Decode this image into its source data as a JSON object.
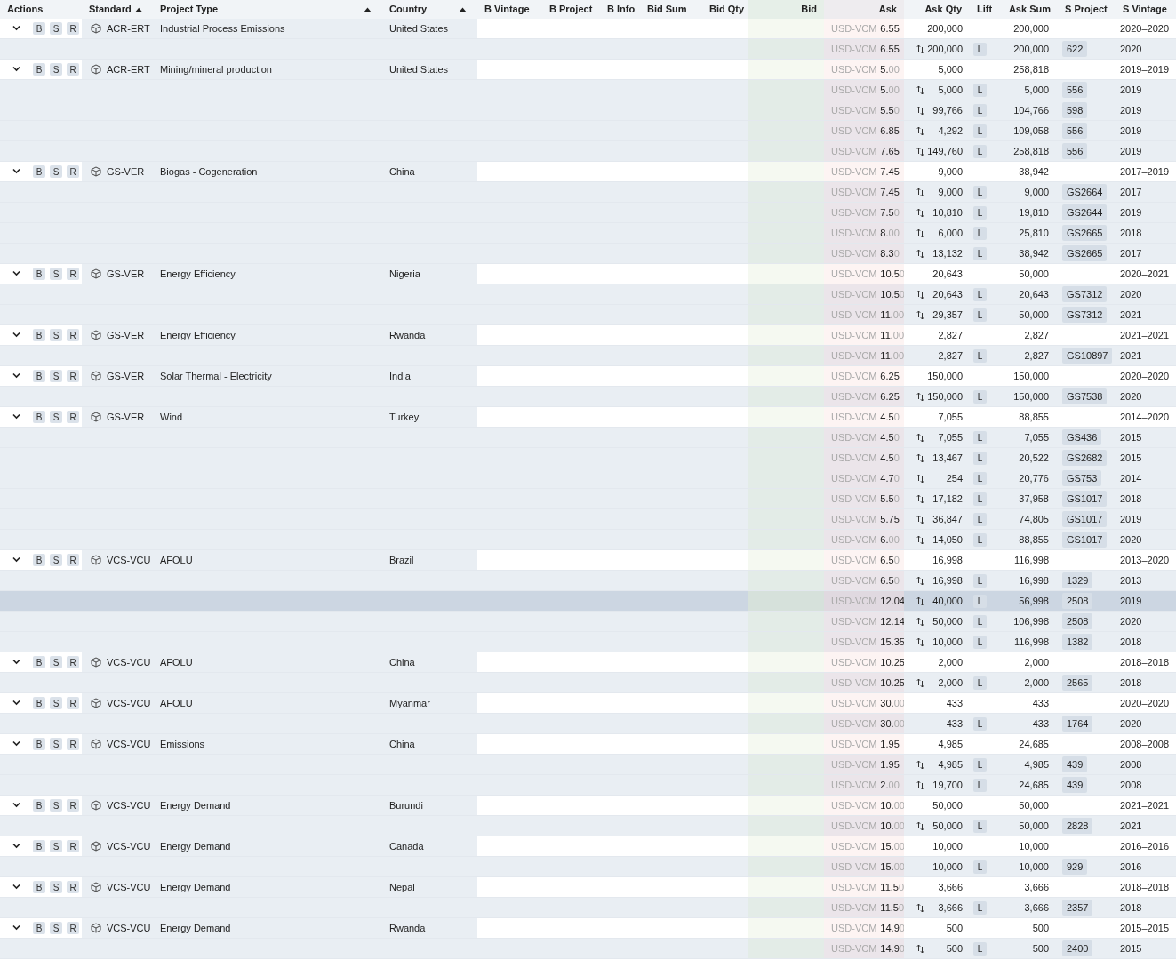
{
  "columns": [
    {
      "label": "Actions",
      "sorted": false
    },
    {
      "label": "Standard",
      "sorted": true
    },
    {
      "label": "Project Type",
      "sorted": true
    },
    {
      "label": "Country",
      "sorted": true
    },
    {
      "label": "B Vintage",
      "sorted": false
    },
    {
      "label": "B Project",
      "sorted": false
    },
    {
      "label": "B Info",
      "sorted": false
    },
    {
      "label": "Bid Sum",
      "sorted": false
    },
    {
      "label": "Bid Qty",
      "sorted": false
    },
    {
      "label": "Bid",
      "sorted": false
    },
    {
      "label": "Ask",
      "sorted": false
    },
    {
      "label": "Ask Qty",
      "sorted": false
    },
    {
      "label": "Lift",
      "sorted": false
    },
    {
      "label": "Ask Sum",
      "sorted": false
    },
    {
      "label": "S Project",
      "sorted": false
    },
    {
      "label": "S Vintage",
      "sorted": false
    }
  ],
  "groups": [
    {
      "expanded": true,
      "actions": [
        "B",
        "S",
        "R"
      ],
      "standard": "ACR-ERT",
      "project_type": "Industrial Process Emissions",
      "country": "United States",
      "summary": {
        "currency": "USD-VCM",
        "ask": "6.55",
        "ask_qty": "200,000",
        "ask_sum": "200,000",
        "s_vintage": "2020–2020"
      },
      "rows": [
        {
          "currency": "USD-VCM",
          "ask": "6.55",
          "swap": true,
          "ask_qty": "200,000",
          "lift": "L",
          "ask_sum": "200,000",
          "s_project": "622",
          "s_vintage": "2020",
          "highlighted": false
        }
      ]
    },
    {
      "expanded": true,
      "actions": [
        "B",
        "S",
        "R"
      ],
      "standard": "ACR-ERT",
      "project_type": "Mining/mineral production",
      "country": "United States",
      "summary": {
        "currency": "USD-VCM",
        "ask": "5.00",
        "ask_qty": "5,000",
        "ask_sum": "258,818",
        "s_vintage": "2019–2019"
      },
      "rows": [
        {
          "currency": "USD-VCM",
          "ask": "5.00",
          "swap": true,
          "ask_qty": "5,000",
          "lift": "L",
          "ask_sum": "5,000",
          "s_project": "556",
          "s_vintage": "2019",
          "highlighted": false
        },
        {
          "currency": "USD-VCM",
          "ask": "5.50",
          "swap": true,
          "ask_qty": "99,766",
          "lift": "L",
          "ask_sum": "104,766",
          "s_project": "598",
          "s_vintage": "2019",
          "highlighted": false
        },
        {
          "currency": "USD-VCM",
          "ask": "6.85",
          "swap": true,
          "ask_qty": "4,292",
          "lift": "L",
          "ask_sum": "109,058",
          "s_project": "556",
          "s_vintage": "2019",
          "highlighted": false
        },
        {
          "currency": "USD-VCM",
          "ask": "7.65",
          "swap": true,
          "ask_qty": "149,760",
          "lift": "L",
          "ask_sum": "258,818",
          "s_project": "556",
          "s_vintage": "2019",
          "highlighted": false
        }
      ]
    },
    {
      "expanded": true,
      "actions": [
        "B",
        "S",
        "R"
      ],
      "standard": "GS-VER",
      "project_type": "Biogas - Cogeneration",
      "country": "China",
      "summary": {
        "currency": "USD-VCM",
        "ask": "7.45",
        "ask_qty": "9,000",
        "ask_sum": "38,942",
        "s_vintage": "2017–2019"
      },
      "rows": [
        {
          "currency": "USD-VCM",
          "ask": "7.45",
          "swap": true,
          "ask_qty": "9,000",
          "lift": "L",
          "ask_sum": "9,000",
          "s_project": "GS2664",
          "s_vintage": "2017",
          "highlighted": false
        },
        {
          "currency": "USD-VCM",
          "ask": "7.50",
          "swap": true,
          "ask_qty": "10,810",
          "lift": "L",
          "ask_sum": "19,810",
          "s_project": "GS2644",
          "s_vintage": "2019",
          "highlighted": false
        },
        {
          "currency": "USD-VCM",
          "ask": "8.00",
          "swap": true,
          "ask_qty": "6,000",
          "lift": "L",
          "ask_sum": "25,810",
          "s_project": "GS2665",
          "s_vintage": "2018",
          "highlighted": false
        },
        {
          "currency": "USD-VCM",
          "ask": "8.30",
          "swap": true,
          "ask_qty": "13,132",
          "lift": "L",
          "ask_sum": "38,942",
          "s_project": "GS2665",
          "s_vintage": "2017",
          "highlighted": false
        }
      ]
    },
    {
      "expanded": true,
      "actions": [
        "B",
        "S",
        "R"
      ],
      "standard": "GS-VER",
      "project_type": "Energy Efficiency",
      "country": "Nigeria",
      "summary": {
        "currency": "USD-VCM",
        "ask": "10.50",
        "ask_qty": "20,643",
        "ask_sum": "50,000",
        "s_vintage": "2020–2021"
      },
      "rows": [
        {
          "currency": "USD-VCM",
          "ask": "10.50",
          "swap": true,
          "ask_qty": "20,643",
          "lift": "L",
          "ask_sum": "20,643",
          "s_project": "GS7312",
          "s_vintage": "2020",
          "highlighted": false
        },
        {
          "currency": "USD-VCM",
          "ask": "11.00",
          "swap": true,
          "ask_qty": "29,357",
          "lift": "L",
          "ask_sum": "50,000",
          "s_project": "GS7312",
          "s_vintage": "2021",
          "highlighted": false
        }
      ]
    },
    {
      "expanded": true,
      "actions": [
        "B",
        "S",
        "R"
      ],
      "standard": "GS-VER",
      "project_type": "Energy Efficiency",
      "country": "Rwanda",
      "summary": {
        "currency": "USD-VCM",
        "ask": "11.00",
        "ask_qty": "2,827",
        "ask_sum": "2,827",
        "s_vintage": "2021–2021"
      },
      "rows": [
        {
          "currency": "USD-VCM",
          "ask": "11.00",
          "swap": false,
          "ask_qty": "2,827",
          "lift": "L",
          "ask_sum": "2,827",
          "s_project": "GS10897",
          "s_vintage": "2021",
          "highlighted": false
        }
      ]
    },
    {
      "expanded": true,
      "actions": [
        "B",
        "S",
        "R"
      ],
      "standard": "GS-VER",
      "project_type": "Solar Thermal - Electricity",
      "country": "India",
      "summary": {
        "currency": "USD-VCM",
        "ask": "6.25",
        "ask_qty": "150,000",
        "ask_sum": "150,000",
        "s_vintage": "2020–2020"
      },
      "rows": [
        {
          "currency": "USD-VCM",
          "ask": "6.25",
          "swap": true,
          "ask_qty": "150,000",
          "lift": "L",
          "ask_sum": "150,000",
          "s_project": "GS7538",
          "s_vintage": "2020",
          "highlighted": false
        }
      ]
    },
    {
      "expanded": true,
      "actions": [
        "B",
        "S",
        "R"
      ],
      "standard": "GS-VER",
      "project_type": "Wind",
      "country": "Turkey",
      "summary": {
        "currency": "USD-VCM",
        "ask": "4.50",
        "ask_qty": "7,055",
        "ask_sum": "88,855",
        "s_vintage": "2014–2020"
      },
      "rows": [
        {
          "currency": "USD-VCM",
          "ask": "4.50",
          "swap": true,
          "ask_qty": "7,055",
          "lift": "L",
          "ask_sum": "7,055",
          "s_project": "GS436",
          "s_vintage": "2015",
          "highlighted": false
        },
        {
          "currency": "USD-VCM",
          "ask": "4.50",
          "swap": true,
          "ask_qty": "13,467",
          "lift": "L",
          "ask_sum": "20,522",
          "s_project": "GS2682",
          "s_vintage": "2015",
          "highlighted": false
        },
        {
          "currency": "USD-VCM",
          "ask": "4.70",
          "swap": true,
          "ask_qty": "254",
          "lift": "L",
          "ask_sum": "20,776",
          "s_project": "GS753",
          "s_vintage": "2014",
          "highlighted": false
        },
        {
          "currency": "USD-VCM",
          "ask": "5.50",
          "swap": true,
          "ask_qty": "17,182",
          "lift": "L",
          "ask_sum": "37,958",
          "s_project": "GS1017",
          "s_vintage": "2018",
          "highlighted": false
        },
        {
          "currency": "USD-VCM",
          "ask": "5.75",
          "swap": true,
          "ask_qty": "36,847",
          "lift": "L",
          "ask_sum": "74,805",
          "s_project": "GS1017",
          "s_vintage": "2019",
          "highlighted": false
        },
        {
          "currency": "USD-VCM",
          "ask": "6.00",
          "swap": true,
          "ask_qty": "14,050",
          "lift": "L",
          "ask_sum": "88,855",
          "s_project": "GS1017",
          "s_vintage": "2020",
          "highlighted": false
        }
      ]
    },
    {
      "expanded": true,
      "actions": [
        "B",
        "S",
        "R"
      ],
      "standard": "VCS-VCU",
      "project_type": "AFOLU",
      "country": "Brazil",
      "summary": {
        "currency": "USD-VCM",
        "ask": "6.50",
        "ask_qty": "16,998",
        "ask_sum": "116,998",
        "s_vintage": "2013–2020"
      },
      "rows": [
        {
          "currency": "USD-VCM",
          "ask": "6.50",
          "swap": true,
          "ask_qty": "16,998",
          "lift": "L",
          "ask_sum": "16,998",
          "s_project": "1329",
          "s_vintage": "2013",
          "highlighted": false
        },
        {
          "currency": "USD-VCM",
          "ask": "12.04",
          "swap": true,
          "ask_qty": "40,000",
          "lift": "L",
          "ask_sum": "56,998",
          "s_project": "2508",
          "s_vintage": "2019",
          "highlighted": true
        },
        {
          "currency": "USD-VCM",
          "ask": "12.14",
          "swap": true,
          "ask_qty": "50,000",
          "lift": "L",
          "ask_sum": "106,998",
          "s_project": "2508",
          "s_vintage": "2020",
          "highlighted": false
        },
        {
          "currency": "USD-VCM",
          "ask": "15.35",
          "swap": true,
          "ask_qty": "10,000",
          "lift": "L",
          "ask_sum": "116,998",
          "s_project": "1382",
          "s_vintage": "2018",
          "highlighted": false
        }
      ]
    },
    {
      "expanded": true,
      "actions": [
        "B",
        "S",
        "R"
      ],
      "standard": "VCS-VCU",
      "project_type": "AFOLU",
      "country": "China",
      "summary": {
        "currency": "USD-VCM",
        "ask": "10.25",
        "ask_qty": "2,000",
        "ask_sum": "2,000",
        "s_vintage": "2018–2018"
      },
      "rows": [
        {
          "currency": "USD-VCM",
          "ask": "10.25",
          "swap": true,
          "ask_qty": "2,000",
          "lift": "L",
          "ask_sum": "2,000",
          "s_project": "2565",
          "s_vintage": "2018",
          "highlighted": false
        }
      ]
    },
    {
      "expanded": true,
      "actions": [
        "B",
        "S",
        "R"
      ],
      "standard": "VCS-VCU",
      "project_type": "AFOLU",
      "country": "Myanmar",
      "summary": {
        "currency": "USD-VCM",
        "ask": "30.00",
        "ask_qty": "433",
        "ask_sum": "433",
        "s_vintage": "2020–2020"
      },
      "rows": [
        {
          "currency": "USD-VCM",
          "ask": "30.00",
          "swap": false,
          "ask_qty": "433",
          "lift": "L",
          "ask_sum": "433",
          "s_project": "1764",
          "s_vintage": "2020",
          "highlighted": false
        }
      ]
    },
    {
      "expanded": true,
      "actions": [
        "B",
        "S",
        "R"
      ],
      "standard": "VCS-VCU",
      "project_type": "Emissions",
      "country": "China",
      "summary": {
        "currency": "USD-VCM",
        "ask": "1.95",
        "ask_qty": "4,985",
        "ask_sum": "24,685",
        "s_vintage": "2008–2008"
      },
      "rows": [
        {
          "currency": "USD-VCM",
          "ask": "1.95",
          "swap": true,
          "ask_qty": "4,985",
          "lift": "L",
          "ask_sum": "4,985",
          "s_project": "439",
          "s_vintage": "2008",
          "highlighted": false
        },
        {
          "currency": "USD-VCM",
          "ask": "2.00",
          "swap": true,
          "ask_qty": "19,700",
          "lift": "L",
          "ask_sum": "24,685",
          "s_project": "439",
          "s_vintage": "2008",
          "highlighted": false
        }
      ]
    },
    {
      "expanded": true,
      "actions": [
        "B",
        "S",
        "R"
      ],
      "standard": "VCS-VCU",
      "project_type": "Energy Demand",
      "country": "Burundi",
      "summary": {
        "currency": "USD-VCM",
        "ask": "10.00",
        "ask_qty": "50,000",
        "ask_sum": "50,000",
        "s_vintage": "2021–2021"
      },
      "rows": [
        {
          "currency": "USD-VCM",
          "ask": "10.00",
          "swap": true,
          "ask_qty": "50,000",
          "lift": "L",
          "ask_sum": "50,000",
          "s_project": "2828",
          "s_vintage": "2021",
          "highlighted": false
        }
      ]
    },
    {
      "expanded": true,
      "actions": [
        "B",
        "S",
        "R"
      ],
      "standard": "VCS-VCU",
      "project_type": "Energy Demand",
      "country": "Canada",
      "summary": {
        "currency": "USD-VCM",
        "ask": "15.00",
        "ask_qty": "10,000",
        "ask_sum": "10,000",
        "s_vintage": "2016–2016"
      },
      "rows": [
        {
          "currency": "USD-VCM",
          "ask": "15.00",
          "swap": false,
          "ask_qty": "10,000",
          "lift": "L",
          "ask_sum": "10,000",
          "s_project": "929",
          "s_vintage": "2016",
          "highlighted": false
        }
      ]
    },
    {
      "expanded": true,
      "actions": [
        "B",
        "S",
        "R"
      ],
      "standard": "VCS-VCU",
      "project_type": "Energy Demand",
      "country": "Nepal",
      "summary": {
        "currency": "USD-VCM",
        "ask": "11.50",
        "ask_qty": "3,666",
        "ask_sum": "3,666",
        "s_vintage": "2018–2018"
      },
      "rows": [
        {
          "currency": "USD-VCM",
          "ask": "11.50",
          "swap": true,
          "ask_qty": "3,666",
          "lift": "L",
          "ask_sum": "3,666",
          "s_project": "2357",
          "s_vintage": "2018",
          "highlighted": false
        }
      ]
    },
    {
      "expanded": true,
      "actions": [
        "B",
        "S",
        "R"
      ],
      "standard": "VCS-VCU",
      "project_type": "Energy Demand",
      "country": "Rwanda",
      "summary": {
        "currency": "USD-VCM",
        "ask": "14.90",
        "ask_qty": "500",
        "ask_sum": "500",
        "s_vintage": "2015–2015"
      },
      "rows": [
        {
          "currency": "USD-VCM",
          "ask": "14.90",
          "swap": true,
          "ask_qty": "500",
          "lift": "L",
          "ask_sum": "500",
          "s_project": "2400",
          "s_vintage": "2015",
          "highlighted": false
        }
      ]
    }
  ]
}
